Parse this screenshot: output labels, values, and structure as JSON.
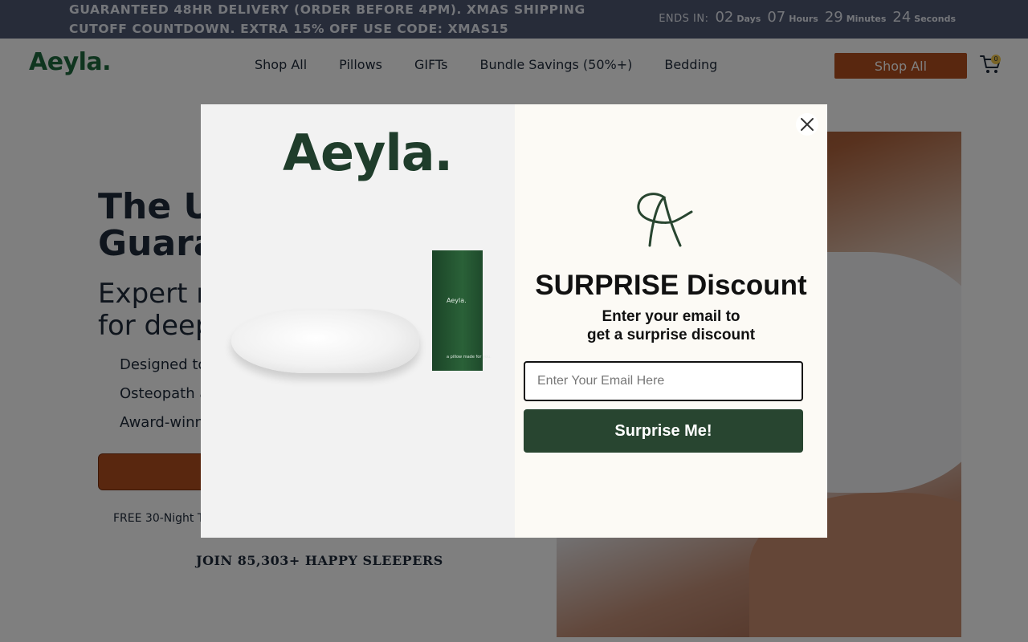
{
  "announcement": {
    "line1": "GUARANTEED 48HR DELIVERY (ORDER BEFORE 4PM). XMAS SHIPPING",
    "line2": "CUTOFF COUNTDOWN. EXTRA 15% OFF USE CODE: XMAS15",
    "countdown_label": "ENDS IN:",
    "days": "02",
    "days_unit": "Days",
    "hours": "07",
    "hours_unit": "Hours",
    "minutes": "29",
    "minutes_unit": "Minutes",
    "seconds": "24",
    "seconds_unit": "Seconds"
  },
  "header": {
    "logo": "Aeyla.",
    "nav": [
      "Shop All",
      "Pillows",
      "GIFTs",
      "Bundle Savings (50%+)",
      "Bedding"
    ],
    "shop_button": "Shop All",
    "cart_count": "0"
  },
  "hero": {
    "title_line1": "The U",
    "title_line2": "Guara",
    "subtitle_line1": "Expert r",
    "subtitle_line2": "for deep",
    "bullets": [
      "Designed to",
      "Osteopath a",
      "Award-winn"
    ],
    "trial_text": "FREE 30-Night T",
    "social_proof": "JOIN 85,303+ HAPPY SLEEPERS"
  },
  "popup": {
    "logo": "Aeyla.",
    "box_brand": "Aeyla.",
    "box_tagline": "a pillow made for you.",
    "title": "SURPRISE Discount",
    "subtitle_line1": "Enter your email to",
    "subtitle_line2": "get a surprise discount",
    "email_placeholder": "Enter Your Email Here",
    "submit_label": "Surprise Me!"
  },
  "colors": {
    "announcement_bg": "#4e5873",
    "brand_green": "#1f6b3f",
    "cta_orange": "#b34e1e",
    "popup_button": "#284530"
  },
  "icons": [
    "cart-icon",
    "close-icon",
    "aeyla-monogram-icon"
  ]
}
